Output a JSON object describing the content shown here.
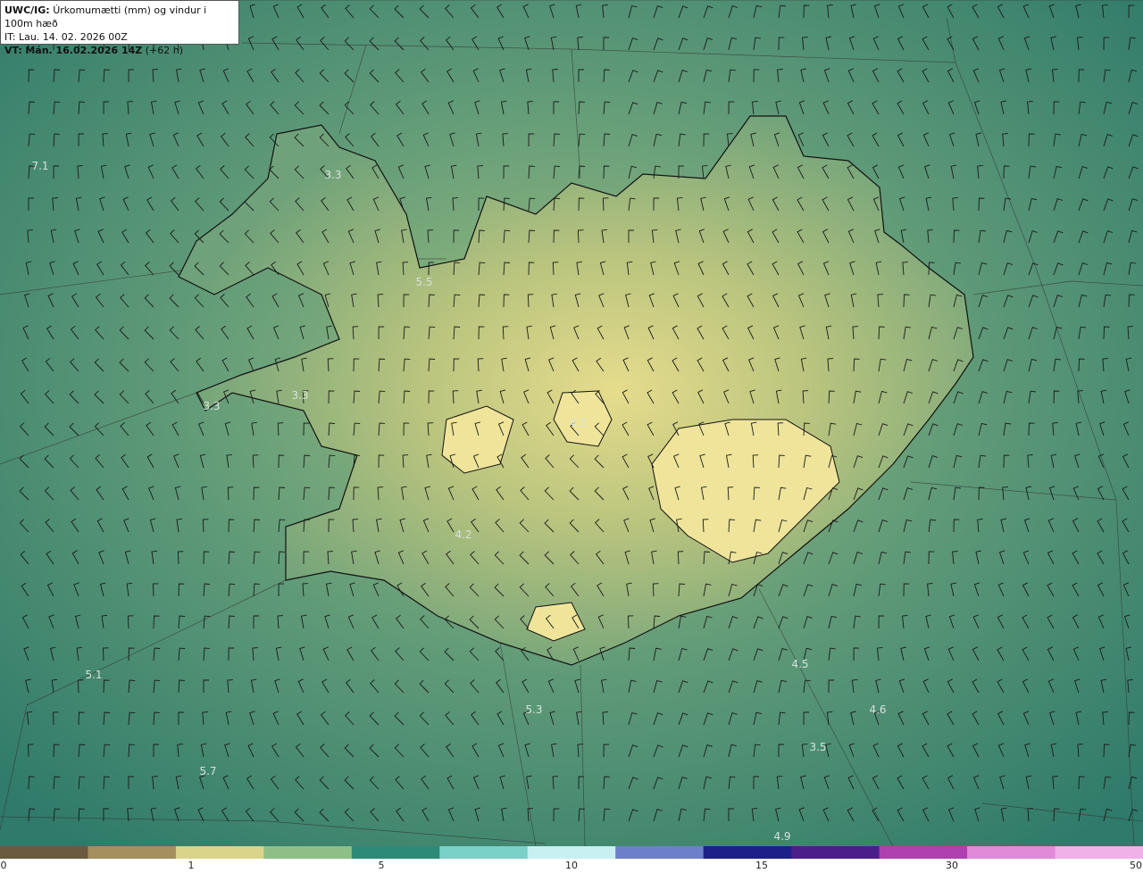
{
  "header": {
    "model": "UWC/IG:",
    "title": "Úrkomumætti (mm) og vindur i 100m hæð",
    "it": "IT: Lau. 14. 02. 2026 00Z",
    "vt_label": "VT:",
    "vt_value": "Mán. 16.02.2026 14Z",
    "vt_offset": "(+62 h)"
  },
  "values": [
    {
      "text": "7.1"
    },
    {
      "text": "3.3"
    },
    {
      "text": "5.5"
    },
    {
      "text": "3.3"
    },
    {
      "text": "3.3"
    },
    {
      "text": "4.2"
    },
    {
      "text": "4.2"
    },
    {
      "text": "5.1"
    },
    {
      "text": "5.3"
    },
    {
      "text": "5.7"
    },
    {
      "text": "4.5"
    },
    {
      "text": "4.6"
    },
    {
      "text": "3.5"
    },
    {
      "text": "4.9"
    }
  ],
  "colorbar": {
    "colors": [
      "#6b5a40",
      "#a58f5f",
      "#d9d48a",
      "#8fbf87",
      "#2e8a78",
      "#7ad1c8",
      "#c8f0f2",
      "#6d7fc9",
      "#1f1f8a",
      "#4b1f8a",
      "#b040b0",
      "#e08ad8",
      "#f0b0e8"
    ],
    "ticks": [
      "0",
      "1",
      "5",
      "10",
      "15",
      "30",
      "50"
    ]
  }
}
